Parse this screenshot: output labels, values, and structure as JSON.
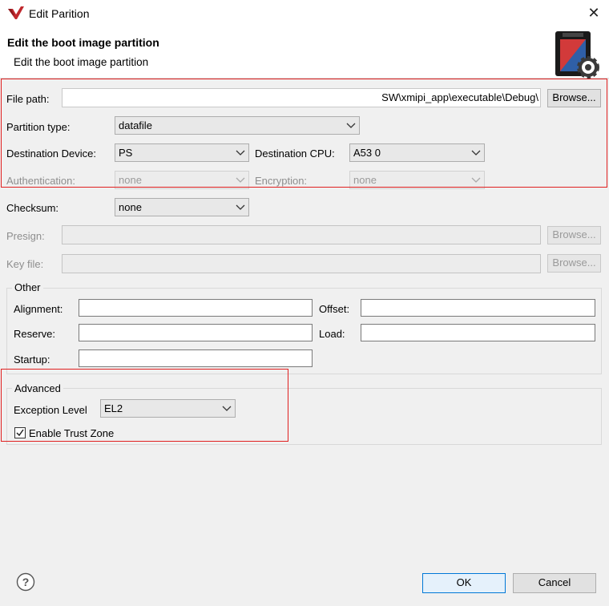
{
  "window": {
    "title": "Edit Parition"
  },
  "banner": {
    "title": "Edit the boot image partition",
    "subtitle": "Edit the boot image partition"
  },
  "form": {
    "file_path": {
      "label": "File path:",
      "value": "SW\\xmipi_app\\executable\\Debug\\",
      "browse": "Browse..."
    },
    "partition_type": {
      "label": "Partition type:",
      "value": "datafile"
    },
    "destination_device": {
      "label": "Destination Device:",
      "value": "PS"
    },
    "destination_cpu": {
      "label": "Destination CPU:",
      "value": "A53 0"
    },
    "authentication": {
      "label": "Authentication:",
      "value": "none"
    },
    "encryption": {
      "label": "Encryption:",
      "value": "none"
    },
    "checksum": {
      "label": "Checksum:",
      "value": "none"
    },
    "presign": {
      "label": "Presign:",
      "value": "",
      "browse": "Browse..."
    },
    "key_file": {
      "label": "Key file:",
      "value": "",
      "browse": "Browse..."
    }
  },
  "other": {
    "title": "Other",
    "alignment": {
      "label": "Alignment:",
      "value": ""
    },
    "offset": {
      "label": "Offset:",
      "value": ""
    },
    "reserve": {
      "label": "Reserve:",
      "value": ""
    },
    "load": {
      "label": "Load:",
      "value": ""
    },
    "startup": {
      "label": "Startup:",
      "value": ""
    }
  },
  "advanced": {
    "title": "Advanced",
    "exception_level": {
      "label": "Exception Level",
      "value": "EL2"
    },
    "trust_zone": {
      "label": "Enable Trust Zone",
      "checked": true
    }
  },
  "footer": {
    "ok": "OK",
    "cancel": "Cancel",
    "help": "?"
  },
  "colors": {
    "highlight": "#e02020",
    "accent": "#0078d7",
    "logo": "#c0282d"
  }
}
